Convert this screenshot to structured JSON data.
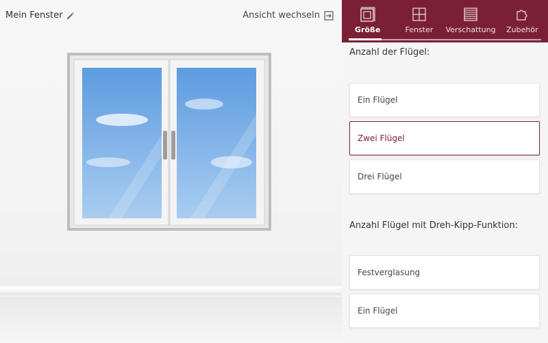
{
  "header": {
    "window_name": "Mein Fenster",
    "switch_view_label": "Ansicht wechseln"
  },
  "tabs": [
    {
      "label": "Größe",
      "icon": "size-icon",
      "active": true
    },
    {
      "label": "Fenster",
      "icon": "window-icon",
      "active": false
    },
    {
      "label": "Verschattung",
      "icon": "shading-icon",
      "active": false
    },
    {
      "label": "Zubehör",
      "icon": "accessory-icon",
      "active": false
    }
  ],
  "sections": {
    "wings_title": "Anzahl der Flügel:",
    "wings_options": [
      "Ein Flügel",
      "Zwei Flügel",
      "Drei Flügel"
    ],
    "wings_selected": "Zwei Flügel",
    "tilt_title": "Anzahl Flügel mit Dreh-Kipp-Funktion:",
    "tilt_options": [
      "Festverglasung",
      "Ein Flügel"
    ]
  },
  "colors": {
    "brand": "#7b2034"
  }
}
